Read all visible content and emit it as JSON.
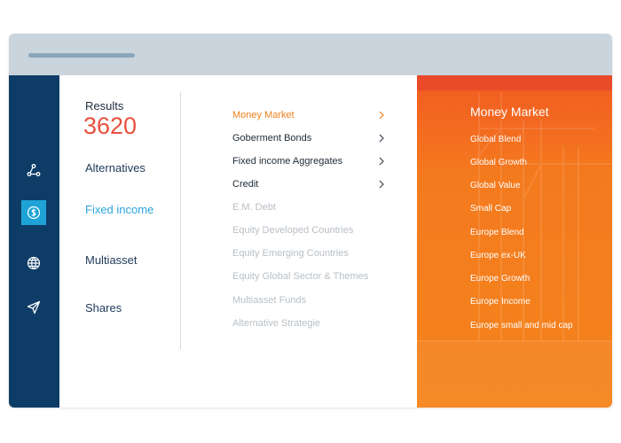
{
  "results": {
    "label": "Results",
    "count": "3620"
  },
  "rail": {
    "items": [
      {
        "icon": "network-icon",
        "active": false
      },
      {
        "icon": "dollar-circle-icon",
        "active": true
      },
      {
        "icon": "globe-icon",
        "active": false
      },
      {
        "icon": "send-icon",
        "active": false
      }
    ]
  },
  "categories": [
    {
      "label": "Alternatives",
      "active": false
    },
    {
      "label": "Fixed income",
      "active": true
    },
    {
      "label": "Multiasset",
      "active": false
    },
    {
      "label": "Shares",
      "active": false
    }
  ],
  "subcategories": [
    {
      "label": "Money Market",
      "state": "active",
      "has_children": true
    },
    {
      "label": "Goberment Bonds",
      "state": "normal",
      "has_children": true
    },
    {
      "label": "Fixed income Aggregates",
      "state": "normal",
      "has_children": true
    },
    {
      "label": "Credit",
      "state": "normal",
      "has_children": true
    },
    {
      "label": "E.M. Debt",
      "state": "disabled",
      "has_children": false
    },
    {
      "label": "Equity Developed Countries",
      "state": "disabled",
      "has_children": false
    },
    {
      "label": "Equity Emerging Countries",
      "state": "disabled",
      "has_children": false
    },
    {
      "label": "Equity Global Sector & Themes",
      "state": "disabled",
      "has_children": false
    },
    {
      "label": "Multiasset Funds",
      "state": "disabled",
      "has_children": false
    },
    {
      "label": "Alternative Strategie",
      "state": "disabled",
      "has_children": false
    }
  ],
  "panel": {
    "title": "Money Market",
    "items": [
      "Global Blend",
      "Global Growth",
      "Global Value",
      "Small Cap",
      "Europe Blend",
      "Europe ex-UK",
      "Europe Growth",
      "Europe Income",
      "Europe small and mid cap"
    ]
  },
  "colors": {
    "rail": "#0d3c66",
    "rail_active": "#1fa3d7",
    "results_count": "#e8503e",
    "category_active": "#2ea3dc",
    "sub_active": "#f07f1a",
    "panel": "#f47a1e"
  }
}
